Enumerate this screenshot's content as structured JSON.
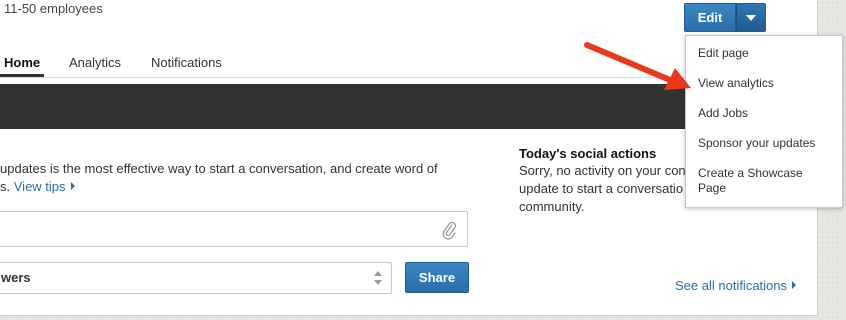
{
  "company": {
    "size_text": "11-50 employees"
  },
  "edit_button": {
    "label": "Edit"
  },
  "edit_menu": {
    "items": [
      {
        "label": "Edit page"
      },
      {
        "label": "View analytics"
      },
      {
        "label": "Add Jobs"
      },
      {
        "label": "Sponsor your updates"
      },
      {
        "label": "Create a Showcase Page"
      }
    ]
  },
  "tabs": [
    {
      "label": "Home",
      "active": true
    },
    {
      "label": "Analytics",
      "active": false
    },
    {
      "label": "Notifications",
      "active": false
    }
  ],
  "share_panel": {
    "intro_line1": "updates is the most effective way to start a conversation, and create word of",
    "intro_line2_prefix": "s.",
    "view_tips_label": "View tips",
    "audience_value": "wers",
    "share_label": "Share"
  },
  "social_actions": {
    "title": "Today's social actions",
    "line1": "Sorry, no activity on your con",
    "line2": "update to start a conversatio",
    "line3": "community."
  },
  "notifications_link": {
    "label": "See all notifications"
  },
  "colors": {
    "primary_button": "#2a6eaa",
    "link": "#2a6db0",
    "dark_band": "#323232",
    "annotation_arrow": "#e8391c"
  }
}
